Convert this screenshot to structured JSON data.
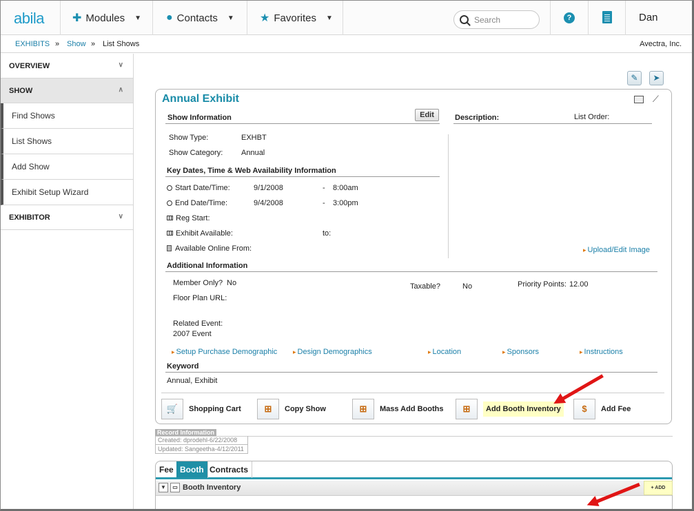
{
  "nav": {
    "logo": "abila",
    "modules": "Modules",
    "contacts": "Contacts",
    "favorites": "Favorites",
    "search_placeholder": "Search",
    "help": "?",
    "user": "Dan"
  },
  "breadcrumb": {
    "items": [
      "EXHIBITS",
      "Show",
      "List Shows"
    ],
    "sep": "»",
    "company": "Avectra, Inc."
  },
  "sidebar": {
    "sections": [
      {
        "label": "OVERVIEW",
        "chevron": "∨"
      },
      {
        "label": "SHOW",
        "chevron": "∧"
      },
      {
        "label": "EXHIBITOR",
        "chevron": "∨"
      }
    ],
    "show_items": [
      "Find Shows",
      "List Shows",
      "Add Show",
      "Exhibit Setup Wizard"
    ]
  },
  "card": {
    "title": "Annual Exhibit",
    "show_info": {
      "heading": "Show Information",
      "edit": "Edit",
      "type_label": "Show Type:",
      "type_value": "EXHBT",
      "category_label": "Show Category:",
      "category_value": "Annual"
    },
    "description_label": "Description:",
    "list_order_label": "List Order:",
    "dates": {
      "heading": "Key Dates, Time & Web Availability Information",
      "start_label": "Start Date/Time:",
      "start_date": "9/1/2008",
      "start_dash": "-",
      "start_time": "8:00am",
      "end_label": "End Date/Time:",
      "end_date": "9/4/2008",
      "end_dash": "-",
      "end_time": "3:00pm",
      "reg_label": "Reg Start:",
      "exhibit_label": "Exhibit Available:",
      "to_label": "to:",
      "online_label": "Available Online From:"
    },
    "upload_link": "Upload/Edit Image",
    "additional": {
      "heading": "Additional Information",
      "member_label": "Member Only?",
      "member_value": "No",
      "taxable_label": "Taxable?",
      "taxable_value": "No",
      "priority_label": "Priority Points:",
      "priority_value": "12.00",
      "floor_label": "Floor Plan URL:",
      "related_label": "Related Event:",
      "related_value": "2007 Event"
    },
    "links": [
      "Setup Purchase Demographic",
      "Design Demographics",
      "Location",
      "Sponsors",
      "Instructions"
    ],
    "keyword": {
      "heading": "Keyword",
      "value": "Annual, Exhibit"
    },
    "actions": [
      "Shopping Cart",
      "Copy Show",
      "Mass Add Booths",
      "Add Booth Inventory",
      "Add Fee"
    ]
  },
  "record_info": {
    "title": "Record Information",
    "created": "Created: dprodehl-6/22/2008",
    "updated": "Updated: Sangeetha-4/12/2011"
  },
  "tabs": {
    "items": [
      "Fee",
      "Booth",
      "Contracts"
    ],
    "active": "Booth",
    "subheading": "Booth Inventory",
    "add": "+ ADD"
  },
  "colors": {
    "accent": "#1f8fa6",
    "link": "#1a7fa8",
    "highlight": "#ffffc4",
    "arrow": "#e01515"
  }
}
